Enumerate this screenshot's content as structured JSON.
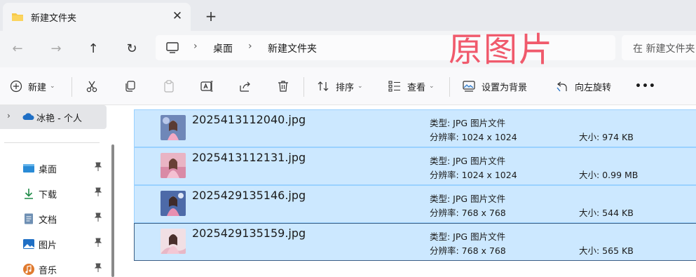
{
  "tab": {
    "title": "新建文件夹",
    "close": "✕",
    "new_tab": "+"
  },
  "nav": {
    "back": "←",
    "forward": "→",
    "up": "↑",
    "refresh": "↻"
  },
  "address": {
    "crumbs": [
      "桌面",
      "新建文件夹"
    ],
    "separator": "›"
  },
  "overlay_text": "原图片",
  "search": {
    "placeholder": "在 新建文件夹"
  },
  "toolbar": {
    "new_label": "新建",
    "sort_label": "排序",
    "view_label": "查看",
    "set_bg_label": "设置为背景",
    "rotate_left_label": "向左旋转",
    "more_label": "•••",
    "caret": "⌄"
  },
  "sidebar": {
    "onedrive": {
      "label": "冰艳 - 个人",
      "chevron": "›"
    },
    "items": [
      {
        "label": "桌面",
        "icon": "desktop-icon"
      },
      {
        "label": "下载",
        "icon": "download-icon"
      },
      {
        "label": "文档",
        "icon": "document-icon"
      },
      {
        "label": "图片",
        "icon": "pictures-icon"
      },
      {
        "label": "音乐",
        "icon": "music-icon"
      }
    ]
  },
  "files": [
    {
      "name": "2025413112040.jpg",
      "type": "类型: JPG 图片文件",
      "resolution": "分辨率: 1024 x 1024",
      "size": "大小: 974 KB"
    },
    {
      "name": "2025413112131.jpg",
      "type": "类型: JPG 图片文件",
      "resolution": "分辨率: 1024 x 1024",
      "size": "大小: 0.99 MB"
    },
    {
      "name": "2025429135146.jpg",
      "type": "类型: JPG 图片文件",
      "resolution": "分辨率: 768 x 768",
      "size": "大小: 544 KB"
    },
    {
      "name": "2025429135159.jpg",
      "type": "类型: JPG 图片文件",
      "resolution": "分辨率: 768 x 768",
      "size": "大小: 565 KB"
    }
  ],
  "colors": {
    "selection_bg": "#cce8ff",
    "selection_border": "#99d1ff",
    "overlay": "#f05a6c",
    "folder": "#f7c948"
  }
}
